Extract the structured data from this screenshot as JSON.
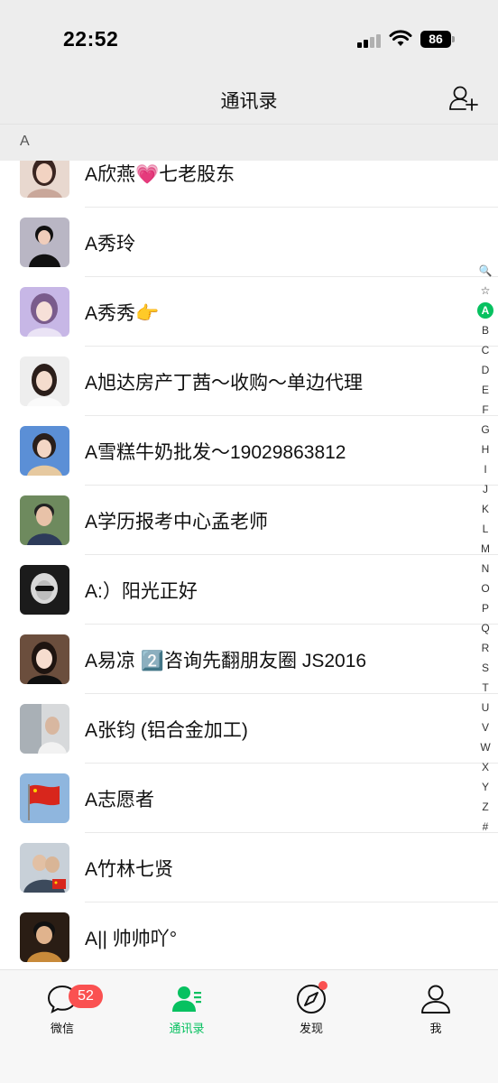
{
  "status_bar": {
    "time": "22:52",
    "battery": "86"
  },
  "header": {
    "title": "通讯录",
    "add_icon": "add-friend-icon"
  },
  "section": {
    "letter": "A"
  },
  "contacts": [
    {
      "name": "A欣燕💗七老股东"
    },
    {
      "name": "A秀玲"
    },
    {
      "name": "A秀秀👉"
    },
    {
      "name": "A旭达房产丁茜～收购～单边代理"
    },
    {
      "name": "A雪糕牛奶批发～19029863812"
    },
    {
      "name": "A学历报考中心孟老师"
    },
    {
      "name": "A:）阳光正好"
    },
    {
      "name": "A易凉 2️⃣咨询先翻朋友圈 JS2016"
    },
    {
      "name": "A张钧 (铝合金加工)"
    },
    {
      "name": "A志愿者"
    },
    {
      "name": "A竹林七贤"
    },
    {
      "name": "A|| 帅帅吖°"
    }
  ],
  "index_bar": [
    "🔍",
    "☆",
    "A",
    "B",
    "C",
    "D",
    "E",
    "F",
    "G",
    "H",
    "I",
    "J",
    "K",
    "L",
    "M",
    "N",
    "O",
    "P",
    "Q",
    "R",
    "S",
    "T",
    "U",
    "V",
    "W",
    "X",
    "Y",
    "Z",
    "#"
  ],
  "index_active": "A",
  "tabs": [
    {
      "label": "微信",
      "icon": "chat-bubble-icon",
      "badge": "52"
    },
    {
      "label": "通讯录",
      "icon": "contacts-icon",
      "active": true
    },
    {
      "label": "发现",
      "icon": "compass-icon",
      "dot": true
    },
    {
      "label": "我",
      "icon": "person-icon"
    }
  ],
  "colors": {
    "accent": "#07c160",
    "badge": "#fa5151",
    "header_bg": "#ededed"
  }
}
